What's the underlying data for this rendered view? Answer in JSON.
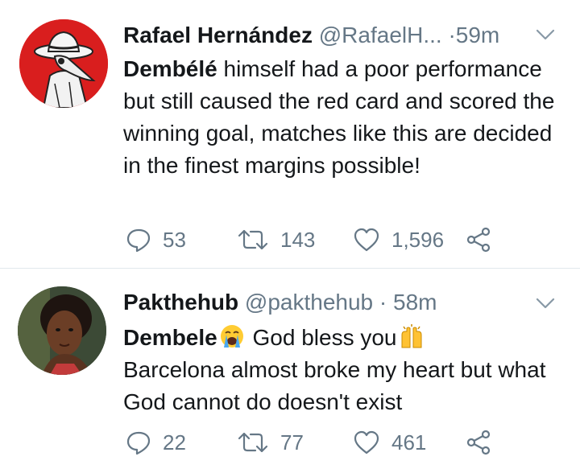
{
  "tweets": [
    {
      "author_name": "Rafael Hernández",
      "author_handle": "@RafaelH...",
      "separator": "·",
      "time": "59m",
      "text_bold": "Dembélé",
      "text_rest": " himself had a poor performance but still caused the red card and scored the winning goal, matches like this are decided in the finest margins possible!",
      "replies": "53",
      "retweets": "143",
      "likes": "1,596"
    },
    {
      "author_name": "Pakthehub",
      "author_handle": "@pakthehub",
      "separator": "·",
      "time": "58m",
      "text_bold": "Dembele",
      "text_mid": " God bless you",
      "text_line2": "Barcelona almost broke my heart but what God cannot do doesn't exist",
      "replies": "22",
      "retweets": "77",
      "likes": "461"
    }
  ],
  "icons": {
    "reply": "reply-icon",
    "retweet": "retweet-icon",
    "like": "heart-icon",
    "share": "share-icon",
    "caret": "chevron-down-icon",
    "emoji1": "crying-face-emoji",
    "emoji2": "raising-hands-emoji"
  },
  "colors": {
    "text": "#14171a",
    "secondary": "#657786",
    "divider": "#e1e8ed",
    "avatar1_bg": "#d91e1e"
  }
}
